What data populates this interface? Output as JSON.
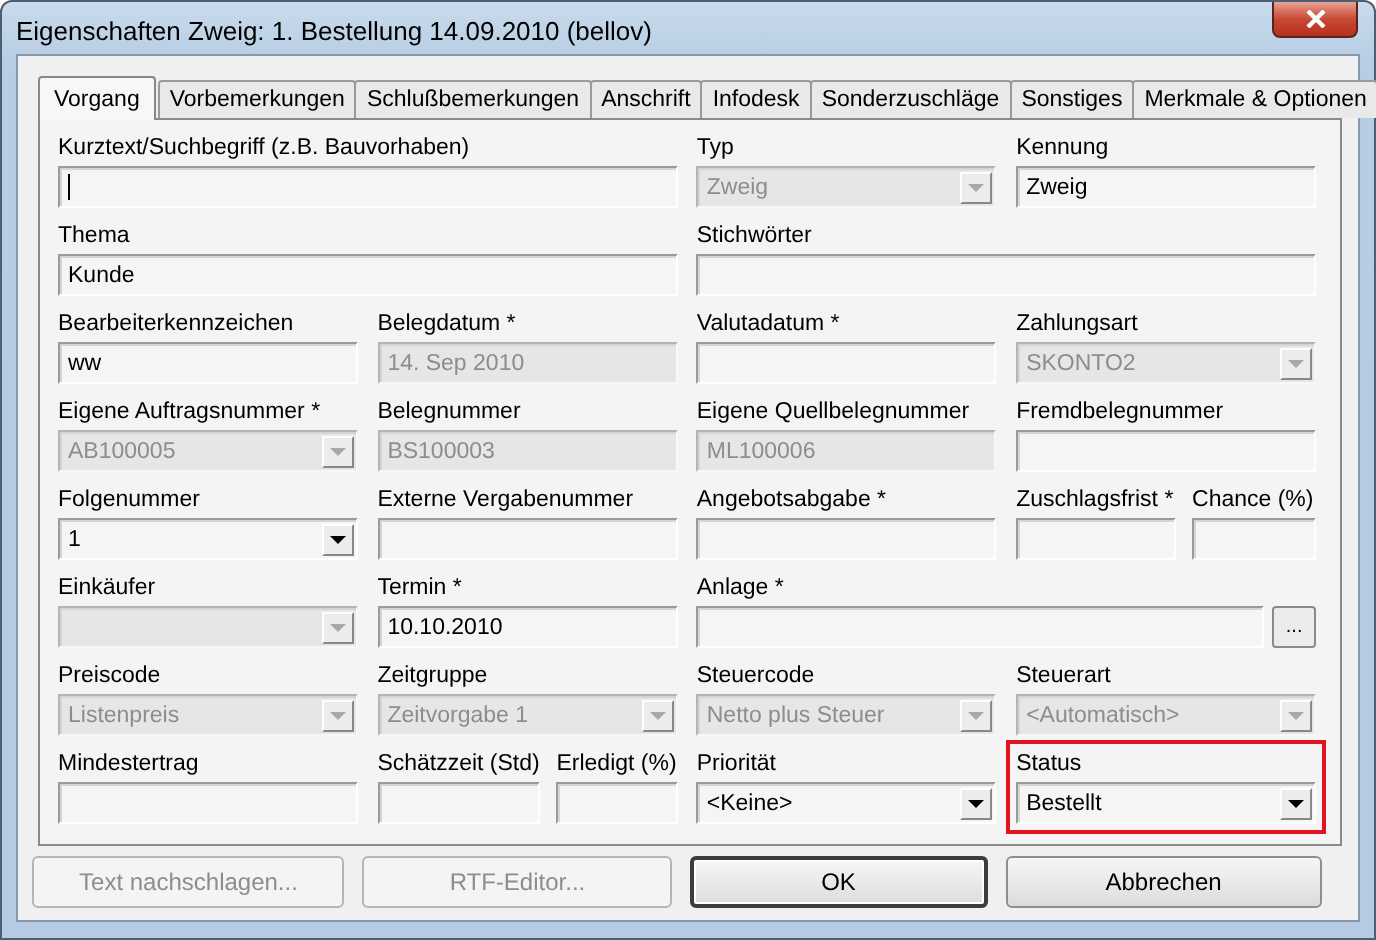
{
  "window": {
    "title": "Eigenschaften Zweig: 1. Bestellung 14.09.2010 (bellov)"
  },
  "tabs": [
    {
      "label": "Vorgang",
      "selected": true
    },
    {
      "label": "Vorbemerkungen",
      "selected": false
    },
    {
      "label": "Schlußbemerkungen",
      "selected": false
    },
    {
      "label": "Anschrift",
      "selected": false
    },
    {
      "label": "Infodesk",
      "selected": false
    },
    {
      "label": "Sonderzuschläge",
      "selected": false
    },
    {
      "label": "Sonstiges",
      "selected": false
    },
    {
      "label": "Merkmale & Optionen",
      "selected": false
    }
  ],
  "rows": [
    [
      [
        {
          "label": "Kurztext/Suchbegriff (z.B. Bauvorhaben)",
          "kind": "text",
          "disabled": false,
          "focused": true
        }
      ],
      [
        {
          "label": "Typ",
          "kind": "combo",
          "value": "Zweig",
          "disabled": true
        }
      ],
      [
        {
          "label": "Kennung",
          "kind": "text",
          "value": "Zweig",
          "disabled": false
        }
      ]
    ],
    [
      [
        {
          "label": "Thema",
          "kind": "text",
          "value": "Kunde",
          "disabled": false
        }
      ],
      [
        {
          "label": "Stichwörter",
          "kind": "text",
          "disabled": false
        }
      ]
    ],
    [
      [
        {
          "label": "Bearbeiterkennzeichen",
          "kind": "text",
          "value": "ww",
          "disabled": false
        }
      ],
      [
        {
          "label": "Belegdatum *",
          "kind": "text",
          "value": "14. Sep 2010",
          "disabled": true
        }
      ],
      [
        {
          "label": "Valutadatum *",
          "kind": "text",
          "disabled": false
        }
      ],
      [
        {
          "label": "Zahlungsart",
          "kind": "combo",
          "value": "SKONTO2",
          "disabled": true
        }
      ]
    ],
    [
      [
        {
          "label": "Eigene Auftragsnummer *",
          "kind": "combo",
          "value": "AB100005",
          "disabled": true
        }
      ],
      [
        {
          "label": "Belegnummer",
          "kind": "text",
          "value": "BS100003",
          "disabled": true
        }
      ],
      [
        {
          "label": "Eigene Quellbelegnummer",
          "kind": "text",
          "value": "ML100006",
          "disabled": true
        }
      ],
      [
        {
          "label": "Fremdbelegnummer",
          "kind": "text",
          "disabled": false
        }
      ]
    ],
    [
      [
        {
          "label": "Folgenummer",
          "kind": "combo",
          "value": "1",
          "disabled": false
        }
      ],
      [
        {
          "label": "Externe Vergabenummer",
          "kind": "text",
          "disabled": false
        }
      ],
      [
        {
          "label": "Angebotsabgabe *",
          "kind": "text",
          "disabled": false
        }
      ],
      [
        {
          "label": "Zuschlagsfrist *",
          "kind": "text",
          "disabled": false
        },
        {
          "label": "Chance (%)",
          "kind": "text",
          "disabled": false
        }
      ]
    ],
    [
      [
        {
          "label": "Einkäufer",
          "kind": "combo",
          "disabled": true
        }
      ],
      [
        {
          "label": "Termin *",
          "kind": "text",
          "value": "10.10.2010",
          "disabled": false
        }
      ],
      [
        {
          "label": "Anlage *",
          "kind": "browse",
          "button_label": "...",
          "disabled": false
        }
      ]
    ],
    [
      [
        {
          "label": "Preiscode",
          "kind": "combo",
          "value": "Listenpreis",
          "disabled": true
        }
      ],
      [
        {
          "label": "Zeitgruppe",
          "kind": "combo",
          "value": "Zeitvorgabe 1",
          "disabled": true
        }
      ],
      [
        {
          "label": "Steuercode",
          "kind": "combo",
          "value": "Netto plus Steuer",
          "disabled": true
        }
      ],
      [
        {
          "label": "Steuerart",
          "kind": "combo",
          "value": "<Automatisch>",
          "disabled": true
        }
      ]
    ],
    [
      [
        {
          "label": "Mindestertrag",
          "kind": "text",
          "disabled": false
        }
      ],
      [
        {
          "label": "Schätzzeit (Std)",
          "kind": "text",
          "disabled": false
        },
        {
          "label": "Erledigt (%)",
          "kind": "text",
          "disabled": false
        }
      ],
      [
        {
          "label": "Priorität",
          "kind": "combo",
          "value": "<Keine>",
          "disabled": false
        }
      ],
      [
        {
          "label": "Status",
          "kind": "combo",
          "value": "Bestellt",
          "disabled": false,
          "highlighted": true
        }
      ]
    ]
  ],
  "buttons": [
    {
      "label": "Text nachschlagen...",
      "disabled": true,
      "default": false
    },
    {
      "label": "RTF-Editor...",
      "disabled": true,
      "default": false
    },
    {
      "label": "OK",
      "disabled": false,
      "default": true
    },
    {
      "label": "Abbrechen",
      "disabled": false,
      "default": false
    }
  ]
}
